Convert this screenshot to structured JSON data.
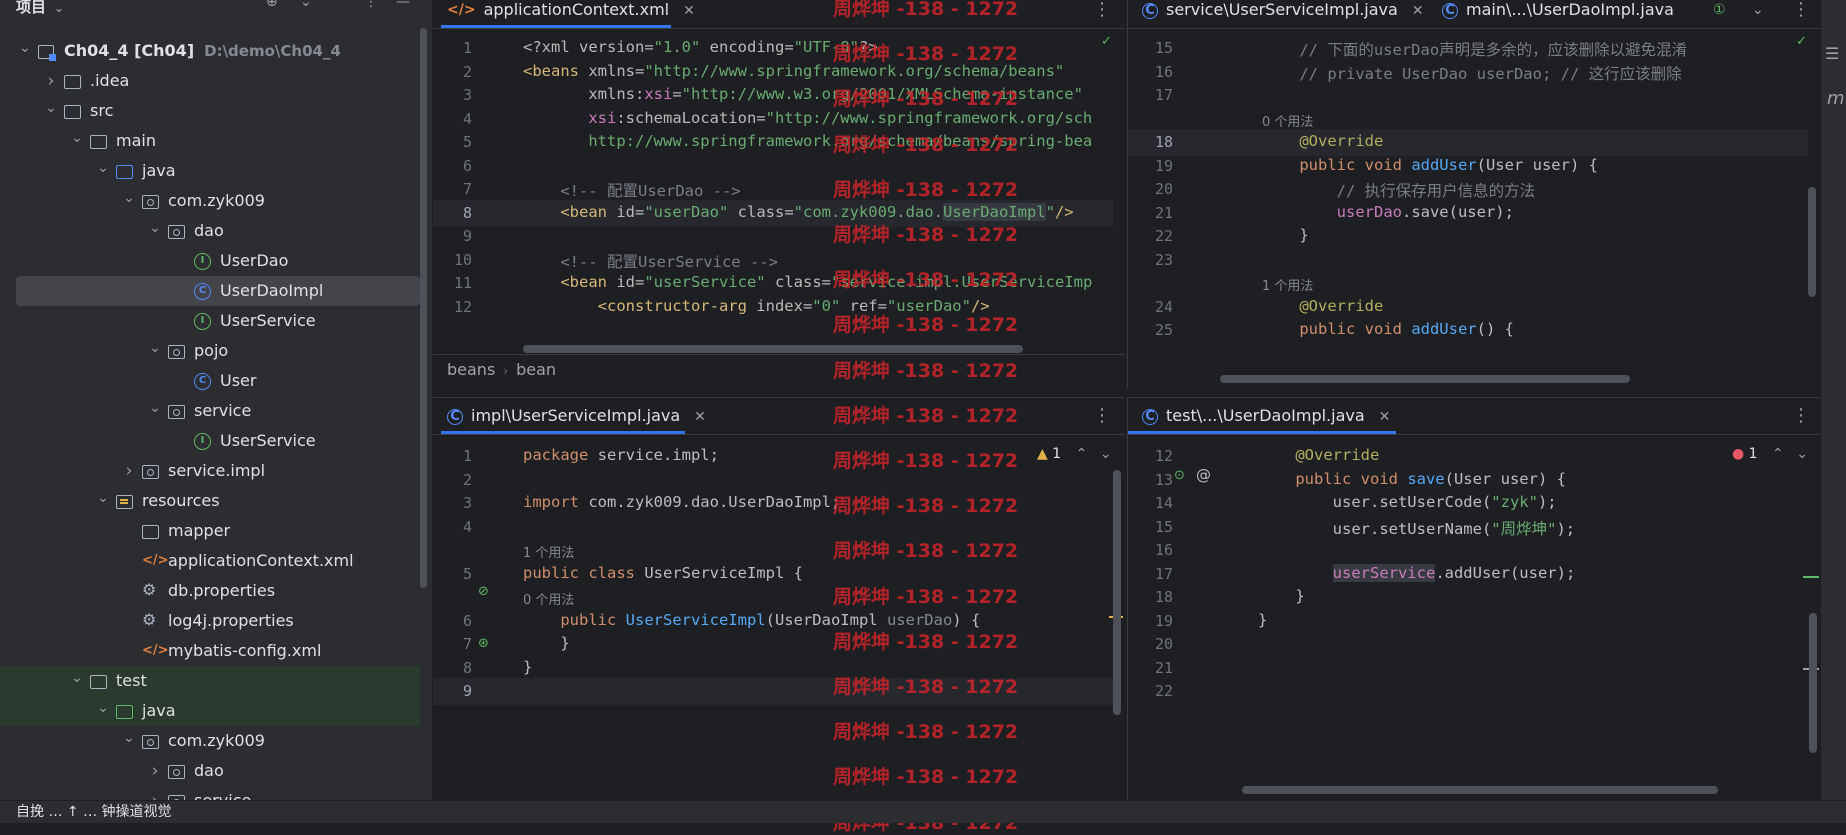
{
  "sidebar": {
    "title": "项目",
    "tree": [
      {
        "label": "Ch04_4 [Ch04]",
        "path": "D:\\demo\\Ch04_4",
        "icon": "module-icon",
        "depth": 0,
        "open": true
      },
      {
        "label": ".idea",
        "icon": "folder-icon",
        "depth": 1,
        "open": false
      },
      {
        "label": "src",
        "icon": "folder-icon",
        "depth": 1,
        "open": true
      },
      {
        "label": "main",
        "icon": "folder-icon",
        "depth": 2,
        "open": true
      },
      {
        "label": "java",
        "icon": "source-folder-icon",
        "depth": 3,
        "open": true
      },
      {
        "label": "com.zyk009",
        "icon": "package-icon",
        "depth": 4,
        "open": true
      },
      {
        "label": "dao",
        "icon": "package-icon",
        "depth": 5,
        "open": true
      },
      {
        "label": "UserDao",
        "icon": "interface-icon",
        "depth": 6
      },
      {
        "label": "UserDaoImpl",
        "icon": "class-icon",
        "depth": 6,
        "selected": true
      },
      {
        "label": "UserService",
        "icon": "interface-icon",
        "depth": 6
      },
      {
        "label": "pojo",
        "icon": "package-icon",
        "depth": 5,
        "open": true
      },
      {
        "label": "User",
        "icon": "class-icon",
        "depth": 6
      },
      {
        "label": "service",
        "icon": "package-icon",
        "depth": 5,
        "open": true
      },
      {
        "label": "UserService",
        "icon": "interface-icon",
        "depth": 6
      },
      {
        "label": "service.impl",
        "icon": "package-icon",
        "depth": 4,
        "open": false
      },
      {
        "label": "resources",
        "icon": "resources-folder-icon",
        "depth": 3,
        "open": true
      },
      {
        "label": "mapper",
        "icon": "folder-icon",
        "depth": 4
      },
      {
        "label": "applicationContext.xml",
        "icon": "xml-icon",
        "depth": 4
      },
      {
        "label": "db.properties",
        "icon": "properties-icon",
        "depth": 4
      },
      {
        "label": "log4j.properties",
        "icon": "properties-icon",
        "depth": 4
      },
      {
        "label": "mybatis-config.xml",
        "icon": "xml-icon",
        "depth": 4
      },
      {
        "label": "test",
        "icon": "folder-icon",
        "depth": 2,
        "open": true,
        "tint": true
      },
      {
        "label": "java",
        "icon": "test-source-folder-icon",
        "depth": 3,
        "open": true,
        "tint": true
      },
      {
        "label": "com.zyk009",
        "icon": "package-icon",
        "depth": 4,
        "open": true
      },
      {
        "label": "dao",
        "icon": "package-icon",
        "depth": 5,
        "open": false
      },
      {
        "label": "service",
        "icon": "package-icon",
        "depth": 5,
        "open": false
      }
    ]
  },
  "editors": {
    "top_left": {
      "tab": "applicationContext.xml",
      "breadcrumb": [
        "beans",
        "bean"
      ],
      "lines": [
        {
          "n": "1",
          "html": "<span class=\"a\">&lt;?xml version=</span><span class=\"s\">\"1.0\"</span><span class=\"a\"> encoding=</span><span class=\"s\">\"UTF-8\"</span><span class=\"a\">?&gt;</span>"
        },
        {
          "n": "2",
          "html": "<span class=\"t\">&lt;beans </span><span class=\"att\">xmlns=</span><span class=\"s\">\"http://www.springframework.org/schema/beans\"</span>"
        },
        {
          "n": "3",
          "html": "       <span class=\"att\">xmlns:</span><span class=\"ns\">xsi</span><span class=\"att\">=</span><span class=\"s\">\"http://www.w3.org/2001/XMLSchema-instance\"</span>"
        },
        {
          "n": "4",
          "html": "       <span class=\"ns\">xsi</span><span class=\"att\">:schemaLocation=</span><span class=\"s\">\"http://www.springframework.org/sch</span>"
        },
        {
          "n": "5",
          "html": "       <span class=\"s\">http://www.springframework.org/schema/beans/spring-bea</span>"
        },
        {
          "n": "6",
          "html": ""
        },
        {
          "n": "7",
          "html": "    <span class=\"c\">&lt;!-- 配置UserDao --&gt;</span>"
        },
        {
          "n": "8",
          "html": "    <span class=\"t\">&lt;bean </span><span class=\"att\">id=</span><span class=\"s\">\"userDao\"</span><span class=\"att\"> class=</span><span class=\"s\">\"com.zyk009.dao.<span class=\"hl\">UserDaoImpl</span>\"</span><span class=\"t\">/&gt;</span>",
          "current": true
        },
        {
          "n": "9",
          "html": ""
        },
        {
          "n": "10",
          "html": "    <span class=\"c\">&lt;!-- 配置UserService --&gt;</span>"
        },
        {
          "n": "11",
          "html": "    <span class=\"t\">&lt;bean </span><span class=\"att\">id=</span><span class=\"s\">\"userService\"</span><span class=\"att\"> class=</span><span class=\"s\">\"service.impl.UserServiceImp</span>"
        },
        {
          "n": "12",
          "html": "        <span class=\"t\">&lt;constructor-arg </span><span class=\"att\">index=</span><span class=\"s\">\"0\"</span><span class=\"att\"> ref=</span><span class=\"s\">\"userDao\"</span><span class=\"t\">/&gt;</span>"
        }
      ]
    },
    "top_right": {
      "tab": "service\\UserServiceImpl.java",
      "tab2": "main\\...\\UserDaoImpl.java",
      "lines": [
        {
          "n": "15",
          "html": "    <span class=\"c\">// 下面的userDao声明是多余的，应该删除以避免混淆</span>"
        },
        {
          "n": "16",
          "html": "    <span class=\"c\">// private UserDao userDao; // 这行应该删除</span>"
        },
        {
          "n": "17",
          "html": ""
        },
        {
          "hint": "0 个用法"
        },
        {
          "n": "18",
          "html": "    <span class=\"an\">@Override</span>",
          "current": true
        },
        {
          "n": "19",
          "html": "    <span class=\"k\">public void </span><span class=\"fn\">addUser</span>(User user) {"
        },
        {
          "n": "20",
          "html": "        <span class=\"c\">// 执行保存用户信息的方法</span>"
        },
        {
          "n": "21",
          "html": "        <span class=\"fl\">userDao</span>.save(user);"
        },
        {
          "n": "22",
          "html": "    }"
        },
        {
          "n": "23",
          "html": ""
        },
        {
          "hint": "1 个用法"
        },
        {
          "n": "24",
          "html": "    <span class=\"an\">@Override</span>"
        },
        {
          "n": "25",
          "html": "    <span class=\"k\">public void </span><span class=\"fn\">addUser</span>() {"
        }
      ]
    },
    "bottom_left": {
      "tab": "impl\\UserServiceImpl.java",
      "warnings": "1",
      "lines": [
        {
          "n": "1",
          "html": "<span class=\"k\">package </span>service.impl;"
        },
        {
          "n": "2",
          "html": ""
        },
        {
          "n": "3",
          "html": "<span class=\"k\">import </span>com.zyk009.dao.UserDaoImpl;"
        },
        {
          "n": "4",
          "html": ""
        },
        {
          "hint": "1 个用法"
        },
        {
          "n": "5",
          "html": "<span class=\"k\">public class </span>UserServiceImpl {"
        },
        {
          "hint": "    0 个用法"
        },
        {
          "n": "6",
          "html": "    <span class=\"k\">public </span><span class=\"fn\">UserServiceImpl</span>(UserDaoImpl <span class=\"pm\">userDao</span>) {"
        },
        {
          "n": "7",
          "html": "    }"
        },
        {
          "n": "8",
          "html": "}"
        },
        {
          "n": "9",
          "html": "",
          "current": true
        }
      ]
    },
    "bottom_right": {
      "tab": "test\\...\\UserDaoImpl.java",
      "errors": "1",
      "lines": [
        {
          "n": "12",
          "html": "    <span class=\"an\">@Override</span>"
        },
        {
          "n": "13",
          "html": "    <span class=\"k\">public void </span><span class=\"fn\">save</span>(User user) {"
        },
        {
          "n": "14",
          "html": "        user.setUserCode(<span class=\"s\">\"zyk\"</span>);"
        },
        {
          "n": "15",
          "html": "        user.setUserName(<span class=\"s\">\"周烨坤\"</span>);"
        },
        {
          "n": "16",
          "html": ""
        },
        {
          "n": "17",
          "html": "        <span class=\"fl hl\">userService</span>.addUser(user);"
        },
        {
          "n": "18",
          "html": "    }"
        },
        {
          "n": "19",
          "html": "}"
        },
        {
          "n": "20",
          "html": ""
        },
        {
          "n": "21",
          "html": ""
        },
        {
          "n": "22",
          "html": ""
        }
      ]
    }
  },
  "watermark": "周烨坤 -138 - 1272",
  "statusbar": {
    "text": "自挽 … ↑ … 钟操道视觉"
  }
}
